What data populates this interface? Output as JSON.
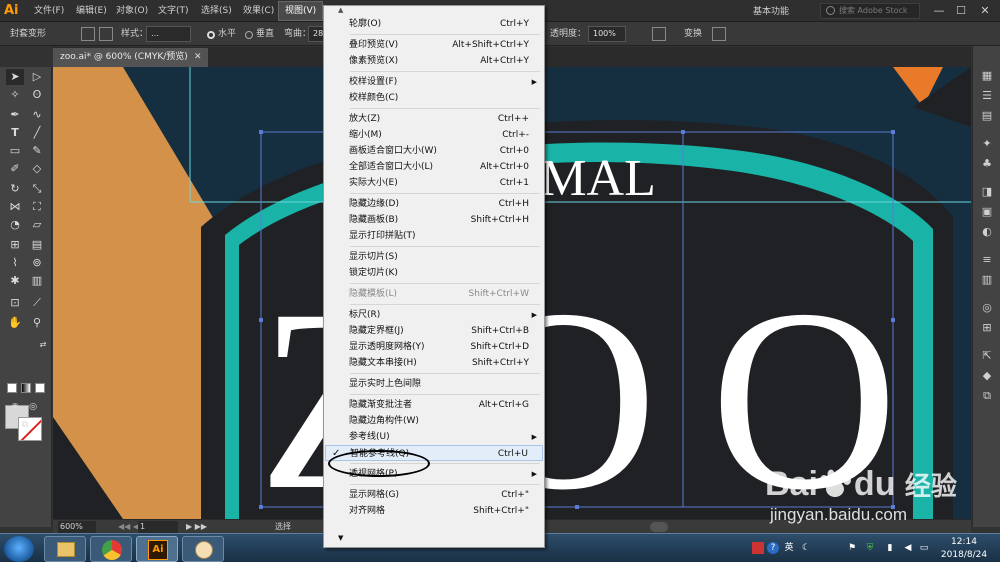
{
  "app": {
    "logo": "Ai"
  },
  "menubar": {
    "items": [
      "文件(F)",
      "编辑(E)",
      "对象(O)",
      "文字(T)",
      "选择(S)",
      "效果(C)",
      "视图(V)"
    ],
    "workspace": "基本功能",
    "search_placeholder": "搜索 Adobe Stock",
    "window_controls": [
      "—",
      "☐",
      "✕"
    ]
  },
  "controlbar": {
    "label": "封套变形",
    "style_label": "样式：",
    "style_value": "…",
    "horizontal": "水平",
    "vertical": "垂直",
    "bend_label": "弯曲：",
    "bend_value": "28%",
    "opacity_label": "透明度：",
    "opacity_value": "100%",
    "transform_label": "变换"
  },
  "document": {
    "tab_title": "zoo.ai* @ 600% (CMYK/预览)",
    "close": "✕",
    "artwork_text_top": "IMAL",
    "artwork_text_main": "ZOO"
  },
  "view_menu": {
    "items": [
      {
        "label": "轮廓(O)",
        "shortcut": "Ctrl+Y"
      },
      {
        "sep": true
      },
      {
        "label": "叠印预览(V)",
        "shortcut": "Alt+Shift+Ctrl+Y"
      },
      {
        "label": "像素预览(X)",
        "shortcut": "Alt+Ctrl+Y"
      },
      {
        "sep": true
      },
      {
        "label": "校样设置(F)",
        "shortcut": "",
        "submenu": true
      },
      {
        "label": "校样颜色(C)",
        "shortcut": ""
      },
      {
        "sep": true
      },
      {
        "label": "放大(Z)",
        "shortcut": "Ctrl++"
      },
      {
        "label": "缩小(M)",
        "shortcut": "Ctrl+-"
      },
      {
        "label": "画板适合窗口大小(W)",
        "shortcut": "Ctrl+0"
      },
      {
        "label": "全部适合窗口大小(L)",
        "shortcut": "Alt+Ctrl+0"
      },
      {
        "label": "实际大小(E)",
        "shortcut": "Ctrl+1"
      },
      {
        "sep": true
      },
      {
        "label": "隐藏边缘(D)",
        "shortcut": "Ctrl+H"
      },
      {
        "label": "隐藏画板(B)",
        "shortcut": "Shift+Ctrl+H"
      },
      {
        "label": "显示打印拼贴(T)",
        "shortcut": ""
      },
      {
        "sep": true
      },
      {
        "label": "显示切片(S)",
        "shortcut": ""
      },
      {
        "label": "锁定切片(K)",
        "shortcut": ""
      },
      {
        "sep": true
      },
      {
        "label": "隐藏模板(L)",
        "shortcut": "Shift+Ctrl+W",
        "disabled": true
      },
      {
        "sep": true
      },
      {
        "label": "标尺(R)",
        "shortcut": "",
        "submenu": true
      },
      {
        "label": "隐藏定界框(J)",
        "shortcut": "Shift+Ctrl+B"
      },
      {
        "label": "显示透明度网格(Y)",
        "shortcut": "Shift+Ctrl+D"
      },
      {
        "label": "隐藏文本串接(H)",
        "shortcut": "Shift+Ctrl+Y"
      },
      {
        "sep": true
      },
      {
        "label": "显示实时上色间隙",
        "shortcut": ""
      },
      {
        "sep": true
      },
      {
        "label": "隐藏渐变批注者",
        "shortcut": "Alt+Ctrl+G"
      },
      {
        "label": "隐藏边角构件(W)",
        "shortcut": ""
      },
      {
        "label": "参考线(U)",
        "shortcut": "",
        "submenu": true
      },
      {
        "label": "智能参考线(Q)",
        "shortcut": "Ctrl+U",
        "checked": true,
        "highlighted": true
      },
      {
        "sep": true
      },
      {
        "label": "透视网格(P)",
        "shortcut": "",
        "submenu": true
      },
      {
        "sep": true
      },
      {
        "label": "显示网格(G)",
        "shortcut": "Ctrl+\""
      },
      {
        "label": "对齐网格",
        "shortcut": "Shift+Ctrl+\""
      }
    ],
    "check_glyph": "✓",
    "submenu_glyph": "▶",
    "scroll_up": "▲",
    "scroll_down": "▼"
  },
  "statusbar": {
    "zoom": "600%",
    "artboard_index": "1",
    "mode": "选择"
  },
  "taskbar": {
    "time": "12:14",
    "date": "2018/8/24",
    "ime": "英",
    "ai_label": "Ai"
  },
  "watermark": {
    "brand": "Bai",
    "brand2": "du",
    "cn": "经验",
    "url": "jingyan.baidu.com"
  },
  "colors": {
    "accent_orange": "#d4914a",
    "teal": "#19b3a7",
    "dark_navy": "#152f40",
    "artwork_dark": "#1f2124"
  }
}
